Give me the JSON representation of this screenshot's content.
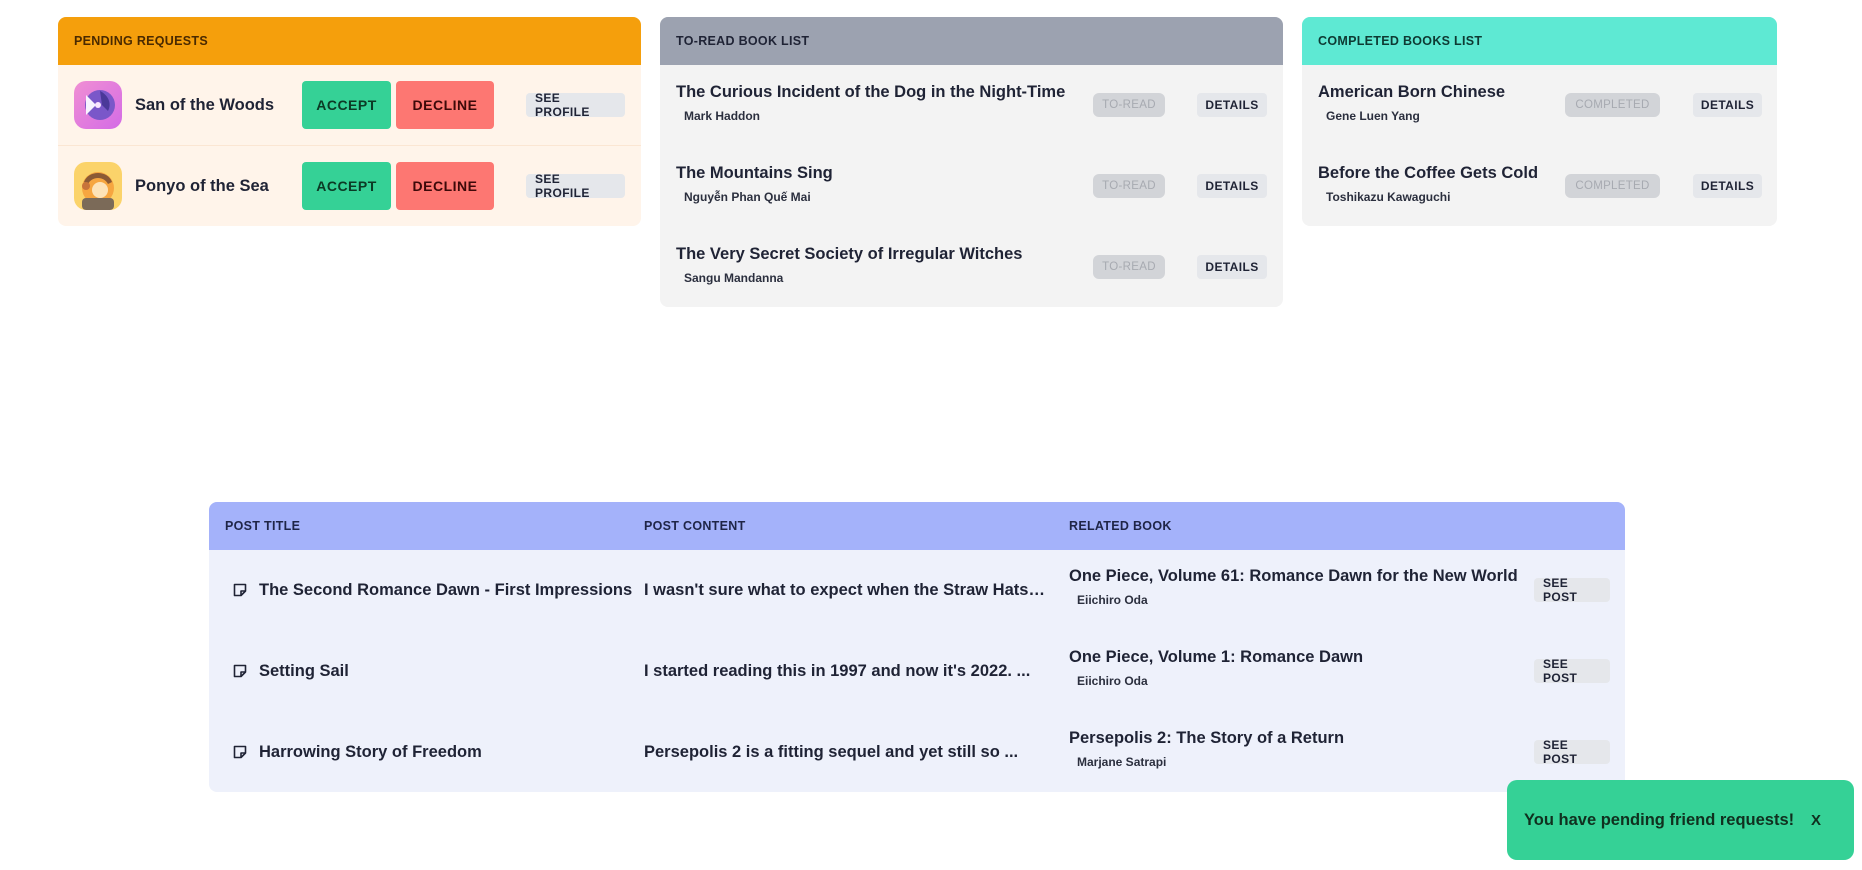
{
  "pending_requests": {
    "header": "PENDING REQUESTS",
    "requests": [
      {
        "name": "San of the Woods",
        "accept_label": "ACCEPT",
        "decline_label": "DECLINE",
        "profile_label": "SEE PROFILE",
        "avatar_icon": "san-avatar"
      },
      {
        "name": "Ponyo of the Sea",
        "accept_label": "ACCEPT",
        "decline_label": "DECLINE",
        "profile_label": "SEE PROFILE",
        "avatar_icon": "ponyo-avatar"
      }
    ]
  },
  "to_read": {
    "header": "TO-READ BOOK LIST",
    "books": [
      {
        "title": "The Curious Incident of the Dog in the Night-Time",
        "author": "Mark Haddon",
        "status": "TO-READ",
        "details_label": "DETAILS"
      },
      {
        "title": "The Mountains Sing",
        "author": "Nguyễn Phan Quế Mai",
        "status": "TO-READ",
        "details_label": "DETAILS"
      },
      {
        "title": "The Very Secret Society of Irregular Witches",
        "author": "Sangu Mandanna",
        "status": "TO-READ",
        "details_label": "DETAILS"
      }
    ]
  },
  "completed": {
    "header": "COMPLETED BOOKS LIST",
    "books": [
      {
        "title": "American Born Chinese",
        "author": "Gene Luen Yang",
        "status": "COMPLETED",
        "details_label": "DETAILS"
      },
      {
        "title": "Before the Coffee Gets Cold",
        "author": "Toshikazu Kawaguchi",
        "status": "COMPLETED",
        "details_label": "DETAILS"
      }
    ]
  },
  "posts": {
    "columns": {
      "title": "POST TITLE",
      "content": "POST CONTENT",
      "related": "RELATED BOOK"
    },
    "rows": [
      {
        "title": "The Second Romance Dawn - First Impressions",
        "content": "I wasn't sure what to expect when the Straw Hats r...",
        "related_title": "One Piece, Volume 61: Romance Dawn for the New World",
        "related_author": "Eiichiro Oda",
        "see_label": "SEE POST"
      },
      {
        "title": "Setting Sail",
        "content": "I started reading this in 1997 and now it's 2022. ...",
        "related_title": "One Piece, Volume 1: Romance Dawn",
        "related_author": "Eiichiro Oda",
        "see_label": "SEE POST"
      },
      {
        "title": "Harrowing Story of Freedom",
        "content": "Persepolis 2 is a fitting sequel and yet still so ...",
        "related_title": "Persepolis 2: The Story of a Return",
        "related_author": "Marjane Satrapi",
        "see_label": "SEE POST"
      }
    ]
  },
  "toast": {
    "message": "You have pending friend requests!",
    "close_label": "X"
  },
  "colors": {
    "pending_header": "#f59f0c",
    "to_read_header": "#9ca2b0",
    "completed_header": "#5ee9d3",
    "posts_header": "#a4b2fa",
    "accept": "#35d196",
    "decline": "#fd7772",
    "toast": "#35d196"
  }
}
